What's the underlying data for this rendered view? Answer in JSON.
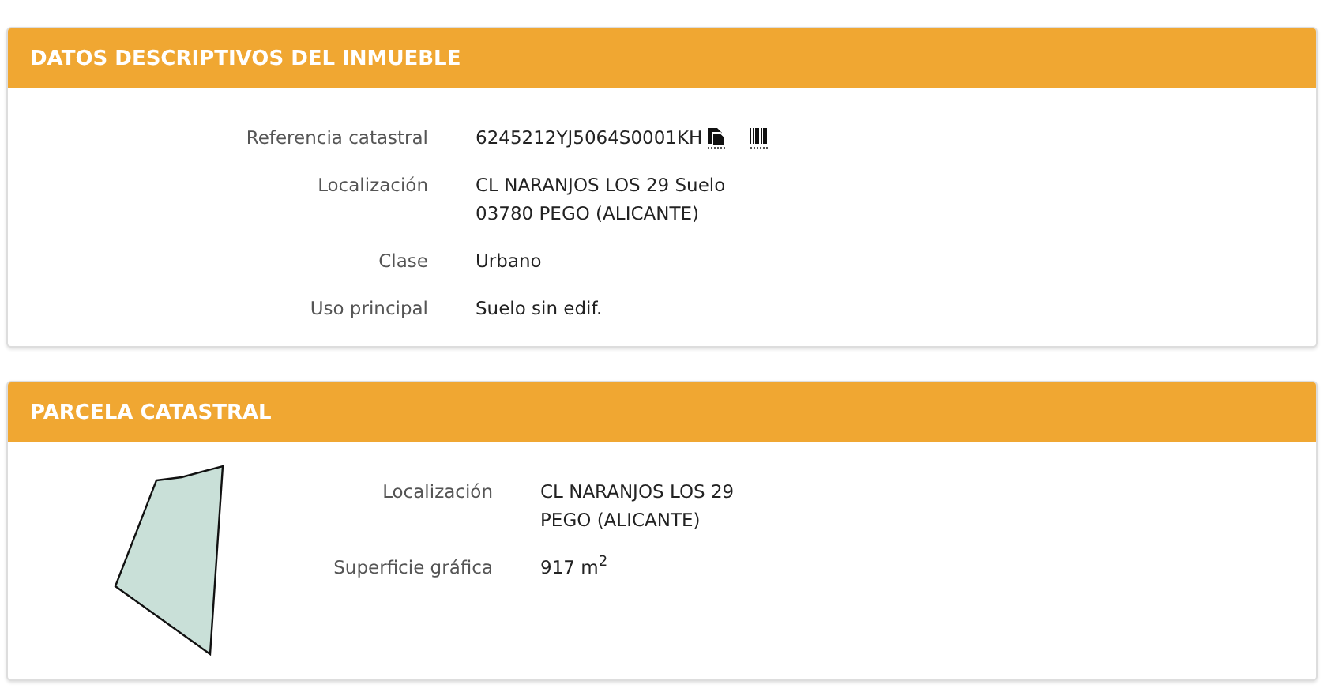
{
  "sections": [
    {
      "kind": "details",
      "title": "DATOS DESCRIPTIVOS DEL INMUEBLE",
      "fields": [
        {
          "label": "Referencia catastral",
          "lines": [
            "6245212YJ5064S0001KH"
          ],
          "icons": true
        },
        {
          "label": "Localización",
          "lines": [
            "CL NARANJOS LOS 29 Suelo",
            "03780 PEGO (ALICANTE)"
          ]
        },
        {
          "label": "Clase",
          "lines": [
            "Urbano"
          ]
        },
        {
          "label": "Uso principal",
          "lines": [
            "Suelo sin edif."
          ]
        }
      ]
    },
    {
      "kind": "parcel",
      "title": "PARCELA CATASTRAL",
      "fields": [
        {
          "label": "Localización",
          "lines": [
            "CL NARANJOS LOS 29",
            "PEGO (ALICANTE)"
          ]
        },
        {
          "label": "Superficie gráfica",
          "lines": [
            "917 m$^{2}$"
          ]
        }
      ]
    }
  ]
}
